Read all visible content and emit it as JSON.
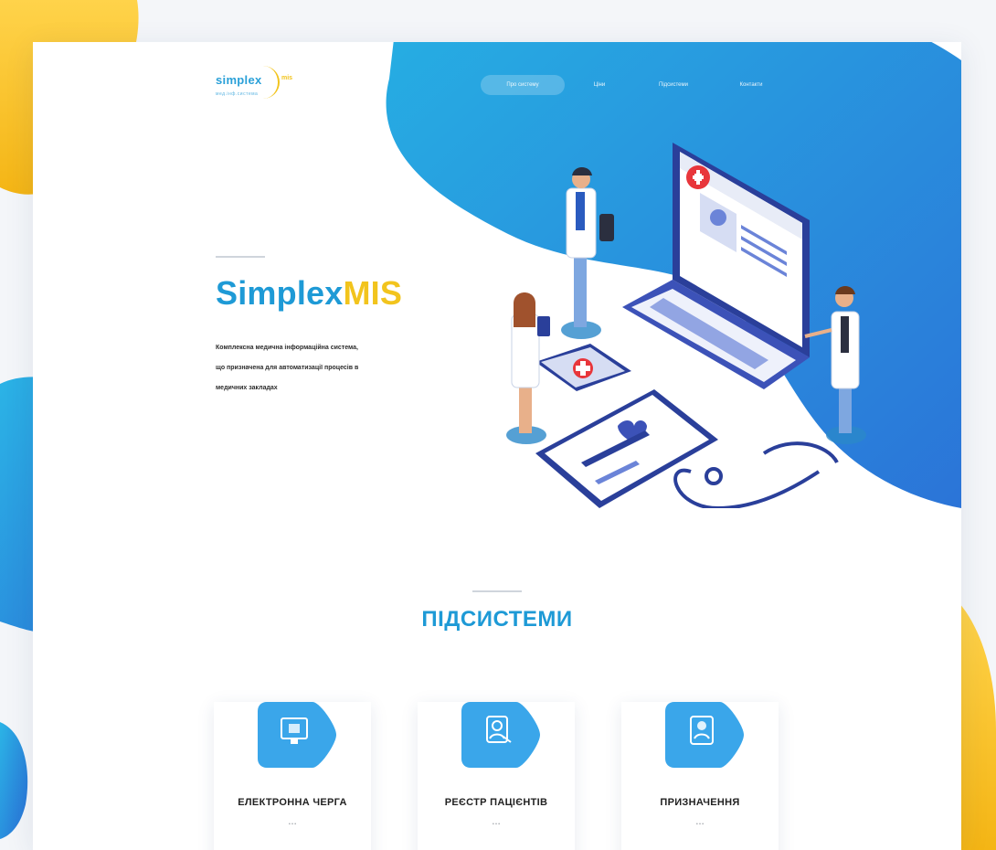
{
  "colors": {
    "primary_blue": "#1e9ad6",
    "accent_yellow": "#f2c41d",
    "text_dark": "#222222"
  },
  "header": {
    "logo": {
      "word": "simplex",
      "tag": "mis",
      "sub": "мед.інф.система"
    },
    "nav": [
      {
        "label": "Про систему",
        "active": true
      },
      {
        "label": "Ціни",
        "active": false
      },
      {
        "label": "Підсистеми",
        "active": false
      },
      {
        "label": "Контакти",
        "active": false
      }
    ]
  },
  "hero": {
    "title_part1": "Simplex",
    "title_part2": "MIS",
    "desc_line1": "Комплексна медична інформаційна система,",
    "desc_line2": "що призначена для автоматизації процесів в",
    "desc_line3": "медичних закладах"
  },
  "subsystems": {
    "title": "ПІДСИСТЕМИ",
    "cards": [
      {
        "title": "ЕЛЕКТРОННА ЧЕРГА",
        "meta": "• • •",
        "icon": "monitor-icon"
      },
      {
        "title": "РЕЄСТР ПАЦІЄНТІВ",
        "meta": "• • •",
        "icon": "patient-registry-icon"
      },
      {
        "title": "ПРИЗНАЧЕННЯ",
        "meta": "• • •",
        "icon": "prescription-icon"
      }
    ]
  },
  "illustration": {
    "icons": [
      "doctor-icon",
      "laptop-icon",
      "tablet-icon",
      "clipboard-icon",
      "stethoscope-icon"
    ]
  }
}
